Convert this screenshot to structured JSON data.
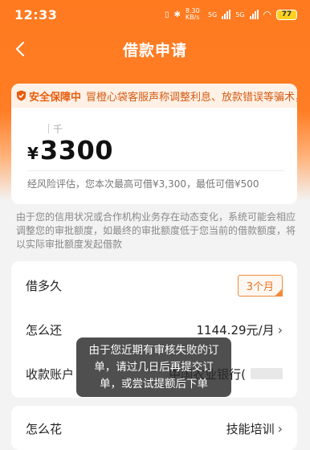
{
  "status_bar": {
    "time": "12:33",
    "net_speed": "8.30 KB/s",
    "sig1": "5G",
    "sig2": "5G",
    "battery": "77"
  },
  "nav": {
    "title": "借款申请"
  },
  "safety": {
    "tag": "安全保障中",
    "text": "冒橙心袋客服声称调整利息、放款错误等骗术，"
  },
  "amount": {
    "unit": "千",
    "symbol": "¥",
    "value": "3300",
    "note": "经风险评估，您本次最高可借¥3,300，最低可借¥500"
  },
  "description": "由于您的信用状况或合作机构业务存在动态变化，系统可能会相应调整您的审批额度，如最终的审批额度低于您当前的借款额度，将以实际审批额度发起借款",
  "loan_details": {
    "duration_label": "借多久",
    "duration_value": "3个月",
    "repay_label": "怎么还",
    "repay_value": "1144.29元/月",
    "account_label": "收款账户",
    "account_value": "中国农业银行("
  },
  "usage": {
    "label": "怎么花",
    "value": "技能培训"
  },
  "toast": {
    "line1": "由于您近期有审核失败的订",
    "line2": "单，请过几日后再提交订",
    "line3": "单，或尝试提额后下单"
  },
  "colors": {
    "brand": "#ff7a1f",
    "accent_text": "#e8701f"
  },
  "icons": {
    "back": "chevron-left-icon",
    "shield": "shield-icon",
    "arrow": "chevron-right-icon"
  }
}
